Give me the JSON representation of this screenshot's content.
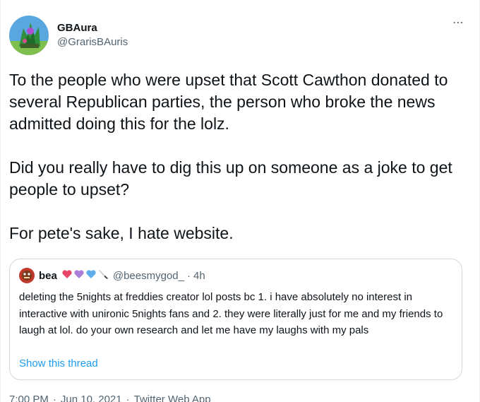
{
  "tweet": {
    "display_name": "GBAura",
    "handle": "@GrarisBAuris",
    "more_icon": "⋯",
    "body": "To the people who were upset that Scott Cawthon donated to several Republican parties, the person who broke the news admitted doing this for the lolz.\n\nDid you really have to dig this up on someone as a joke to get people to upset?\n\nFor pete's sake, I hate website.",
    "time": "7:00 PM",
    "date": "Jun 10, 2021",
    "separator": "·",
    "app": "Twitter Web App"
  },
  "quote": {
    "display_name": "bea",
    "emoji": [
      "pink-heart-icon",
      "purple-heart-icon",
      "blue-heart-icon",
      "knife-icon"
    ],
    "handle": "@beesmygod_",
    "separator": "·",
    "time": "4h",
    "text": "deleting the 5nights at freddies creator lol posts bc 1. i have absolutely no interest in interactive with unironic 5nights fans and 2. they were literally just for me and my friends to laugh at lol. do your own research and let me have my laughs with my pals",
    "show_thread": "Show this thread"
  },
  "colors": {
    "text": "#0f1419",
    "secondary": "#536471",
    "link": "#1d9bf0",
    "border": "#cfd9de"
  }
}
